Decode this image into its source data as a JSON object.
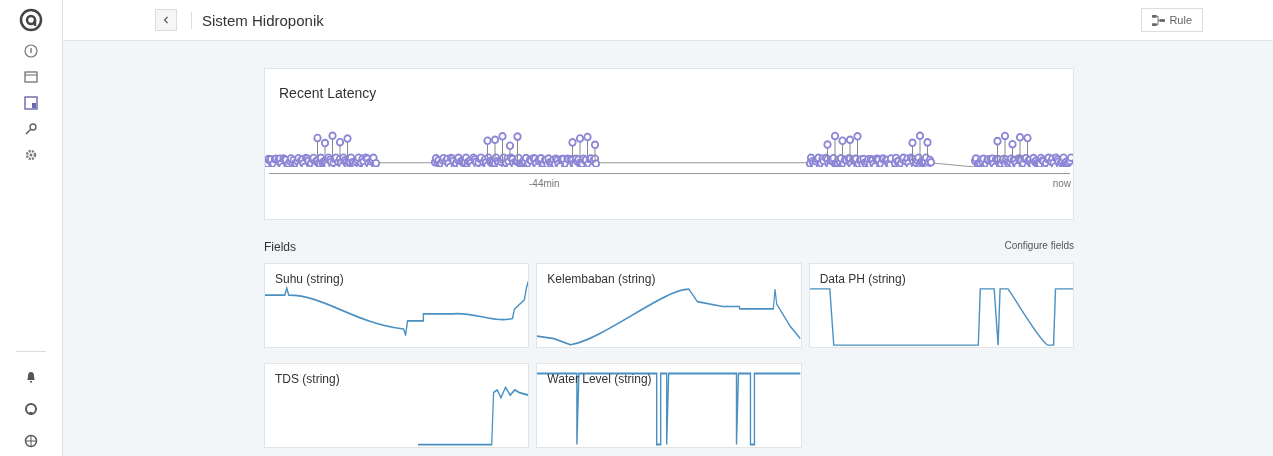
{
  "header": {
    "title": "Sistem Hidroponik",
    "rule_button": "Rule"
  },
  "latency": {
    "title": "Recent Latency",
    "ticks": [
      "-44min",
      "now"
    ]
  },
  "fields": {
    "title": "Fields",
    "configure": "Configure fields",
    "items": [
      {
        "label": "Suhu (string)"
      },
      {
        "label": "Kelembaban (string)"
      },
      {
        "label": "Data PH (string)"
      },
      {
        "label": "TDS (string)"
      },
      {
        "label": "Water Level (string)"
      }
    ]
  }
}
